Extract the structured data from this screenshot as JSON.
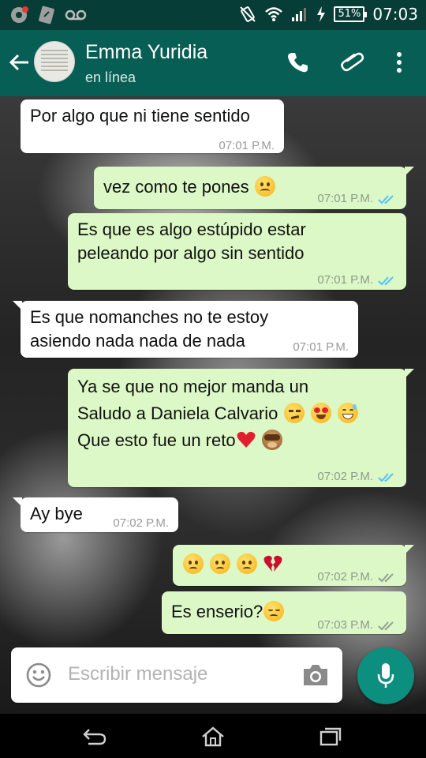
{
  "status_bar": {
    "battery": "51%",
    "time": "07:03"
  },
  "header": {
    "contact_name": "Emma Yuridia",
    "contact_status": "en línea"
  },
  "messages": [
    {
      "dir": "in",
      "text": "Por algo que ni tiene sentido",
      "time": "07:01 P.M."
    },
    {
      "dir": "out",
      "text": "vez como te pones",
      "emoji": [
        "frowning-face"
      ],
      "time": "07:01 P.M.",
      "read": true
    },
    {
      "dir": "out",
      "lines": [
        "Es que es algo estúpido estar",
        "peleando por algo sin sentido"
      ],
      "time": "07:01 P.M.",
      "read": true
    },
    {
      "dir": "in",
      "lines": [
        "Es que nomanches no te estoy",
        "asiendo nada nada de nada"
      ],
      "time": "07:01 P.M."
    },
    {
      "dir": "out",
      "lines": [
        "Ya se que no mejor manda un",
        "Saludo a Daniela Calvario",
        "Que esto fue un reto"
      ],
      "emoji_line2": [
        "smirking-face",
        "heart-eyes-face",
        "sweat-smile-face"
      ],
      "emoji_line3": [
        "red-heart",
        "see-no-evil-monkey"
      ],
      "time": "07:02 P.M.",
      "read": true
    },
    {
      "dir": "in",
      "text": "Ay bye",
      "time": "07:02 P.M."
    },
    {
      "dir": "out",
      "emoji": [
        "worried-face",
        "worried-face",
        "worried-face",
        "broken-heart"
      ],
      "time": "07:02 P.M.",
      "read": false
    },
    {
      "dir": "out",
      "text": "Es enserio?",
      "emoji": [
        "disappointed-face"
      ],
      "time": "07:03 P.M.",
      "read": false
    }
  ],
  "composer": {
    "placeholder": "Escribir mensaje"
  },
  "colors": {
    "header": "#075e54",
    "status_bar": "#073d37",
    "outgoing_bubble": "#dcf8c6",
    "incoming_bubble": "#ffffff",
    "read_ticks": "#4fc3f7",
    "sent_ticks": "#92a092",
    "mic_button": "#0d8f7f"
  }
}
